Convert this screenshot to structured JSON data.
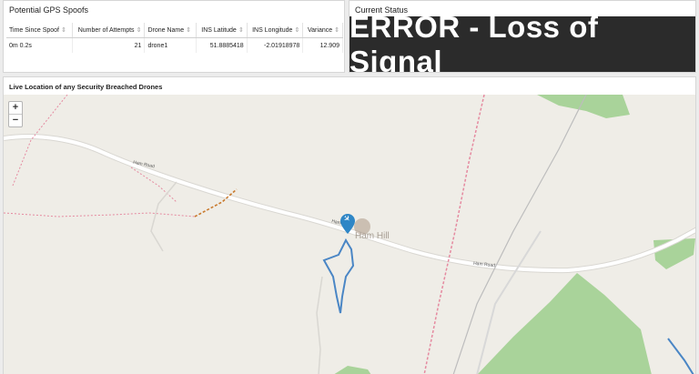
{
  "spoofs_panel": {
    "title": "Potential GPS Spoofs",
    "columns": [
      "Time Since Spoof",
      "Number of Attempts",
      "Drone Name",
      "INS Latitude",
      "INS Longitude",
      "Variance"
    ],
    "rows": [
      [
        "0m 0.2s",
        "21",
        "drone1",
        "51.8885418",
        "-2.01918978",
        "12.909"
      ]
    ]
  },
  "status_panel": {
    "title": "Current Status",
    "message": "ERROR - Loss of Signal",
    "bg_color": "#2b2b2b"
  },
  "map_panel": {
    "title": "Live Location of any Security Breached Drones",
    "zoom_in": "+",
    "zoom_out": "−",
    "road_label_1": "Ham Road",
    "road_label_2": "Ham Road",
    "road_label_3": "Ham Road",
    "place_label": "Ham Hill",
    "marker_icon": "airplane-icon",
    "colors": {
      "water": "#4a86c5",
      "park": "#8fc07a",
      "marker": "#2e86c6",
      "path": "#e58aa0"
    }
  }
}
